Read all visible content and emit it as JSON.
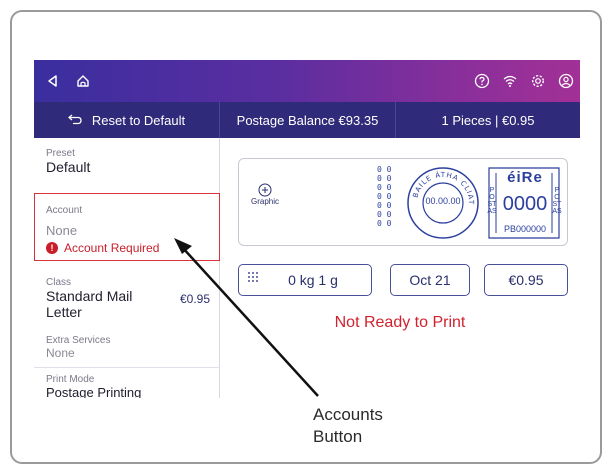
{
  "topbar": {
    "icons": [
      "back-icon",
      "home-icon",
      "help-icon",
      "wifi-icon",
      "settings-icon",
      "user-icon"
    ]
  },
  "infobar": {
    "reset_label": "Reset to Default",
    "postage_balance": "Postage Balance €93.35",
    "pieces": "1 Pieces | €0.95"
  },
  "sidebar": {
    "preset_label": "Preset",
    "preset_value": "Default",
    "account_label": "Account",
    "account_value": "None",
    "account_warning": "Account Required",
    "class_label": "Class",
    "class_value_line1": "Standard Mail",
    "class_value_line2": "Letter",
    "class_price": "€0.95",
    "extra_label": "Extra Services",
    "extra_value": "None",
    "print_mode_label": "Print Mode",
    "print_mode_value": "Postage Printing"
  },
  "stamp": {
    "graphic_label": "Graphic",
    "ring_text": "BAILE ÁTHA CLIATH",
    "date_text": "00.00.00",
    "side_left": "POSTAS",
    "side_right": "POSTAS",
    "brand": "éiRe",
    "amount": "0000",
    "meter_id": "PB000000",
    "zeros": [
      "0 0",
      "0 0",
      "0 0",
      "0 0",
      "0 0",
      "0 0",
      "0 0"
    ]
  },
  "chips": {
    "weight": "0 kg 1 g",
    "date": "Oct 21",
    "amount": "€0.95"
  },
  "status": "Not Ready to Print",
  "callout": {
    "line1": "Accounts",
    "line2": "Button"
  },
  "colors": {
    "topbar_start": "#3a2e9f",
    "topbar_end": "#a23096",
    "infobar": "#2f2a7a",
    "error_red": "#d0222e",
    "chip_border": "#4a4f9a",
    "stamp_blue": "#2b3f9e"
  }
}
